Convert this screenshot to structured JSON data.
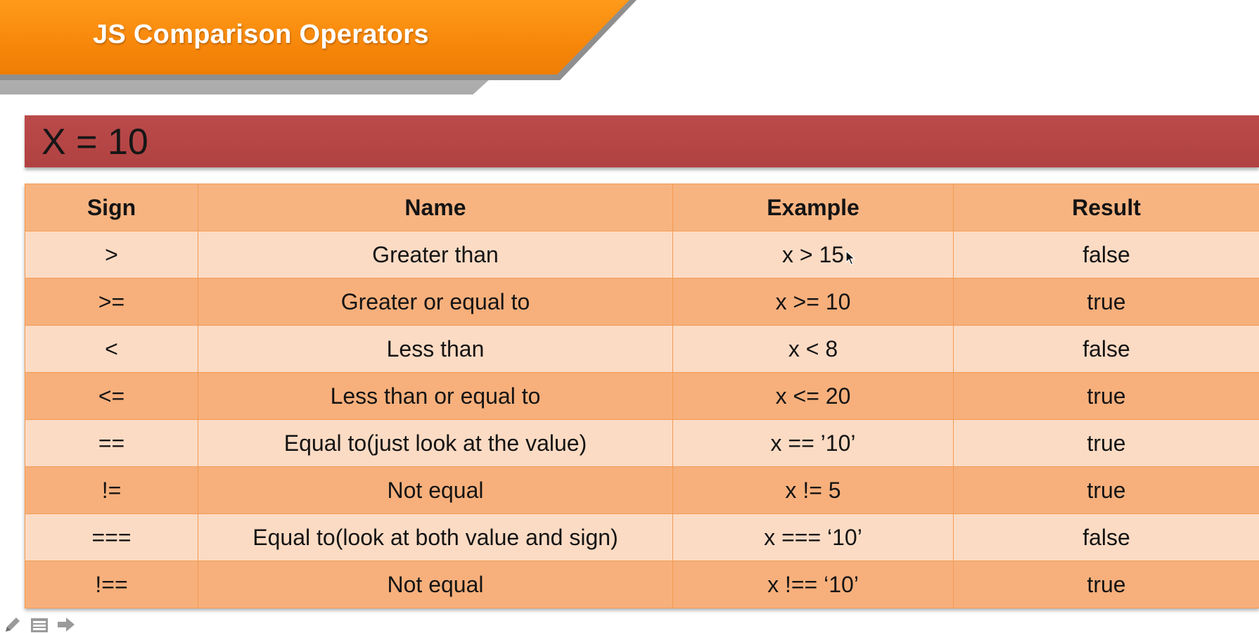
{
  "slide": {
    "title": "JS Comparison Operators",
    "variable_label": "X = 10"
  },
  "table": {
    "headers": {
      "sign": "Sign",
      "name": "Name",
      "example": "Example",
      "result": "Result"
    },
    "rows": [
      {
        "sign": ">",
        "name": "Greater than",
        "example": "x > 15",
        "result": "false"
      },
      {
        "sign": ">=",
        "name": "Greater or equal to",
        "example": "x >= 10",
        "result": "true"
      },
      {
        "sign": "<",
        "name": "Less than",
        "example": "x < 8",
        "result": "false"
      },
      {
        "sign": "<=",
        "name": "Less than or equal to",
        "example": "x <= 20",
        "result": "true"
      },
      {
        "sign": "==",
        "name": "Equal to(just look at the value)",
        "example": "x == ’10’",
        "result": "true"
      },
      {
        "sign": "!=",
        "name": "Not equal",
        "example": "x != 5",
        "result": "true"
      },
      {
        "sign": "===",
        "name": "Equal to(look at both value and sign)",
        "example": "x === ‘10’",
        "result": "false"
      },
      {
        "sign": "!==",
        "name": "Not equal",
        "example": "x !== ‘10’",
        "result": "true"
      }
    ]
  },
  "toolbar_icons": [
    "pen-icon",
    "slides-menu-icon",
    "arrow-right-icon"
  ],
  "colors": {
    "banner_orange": "#f7870a",
    "variable_bar_red": "#b14242",
    "table_header": "#f7b481",
    "row_light": "#fcdbc4",
    "row_dark": "#f7b07c",
    "table_border": "#f39a52"
  }
}
